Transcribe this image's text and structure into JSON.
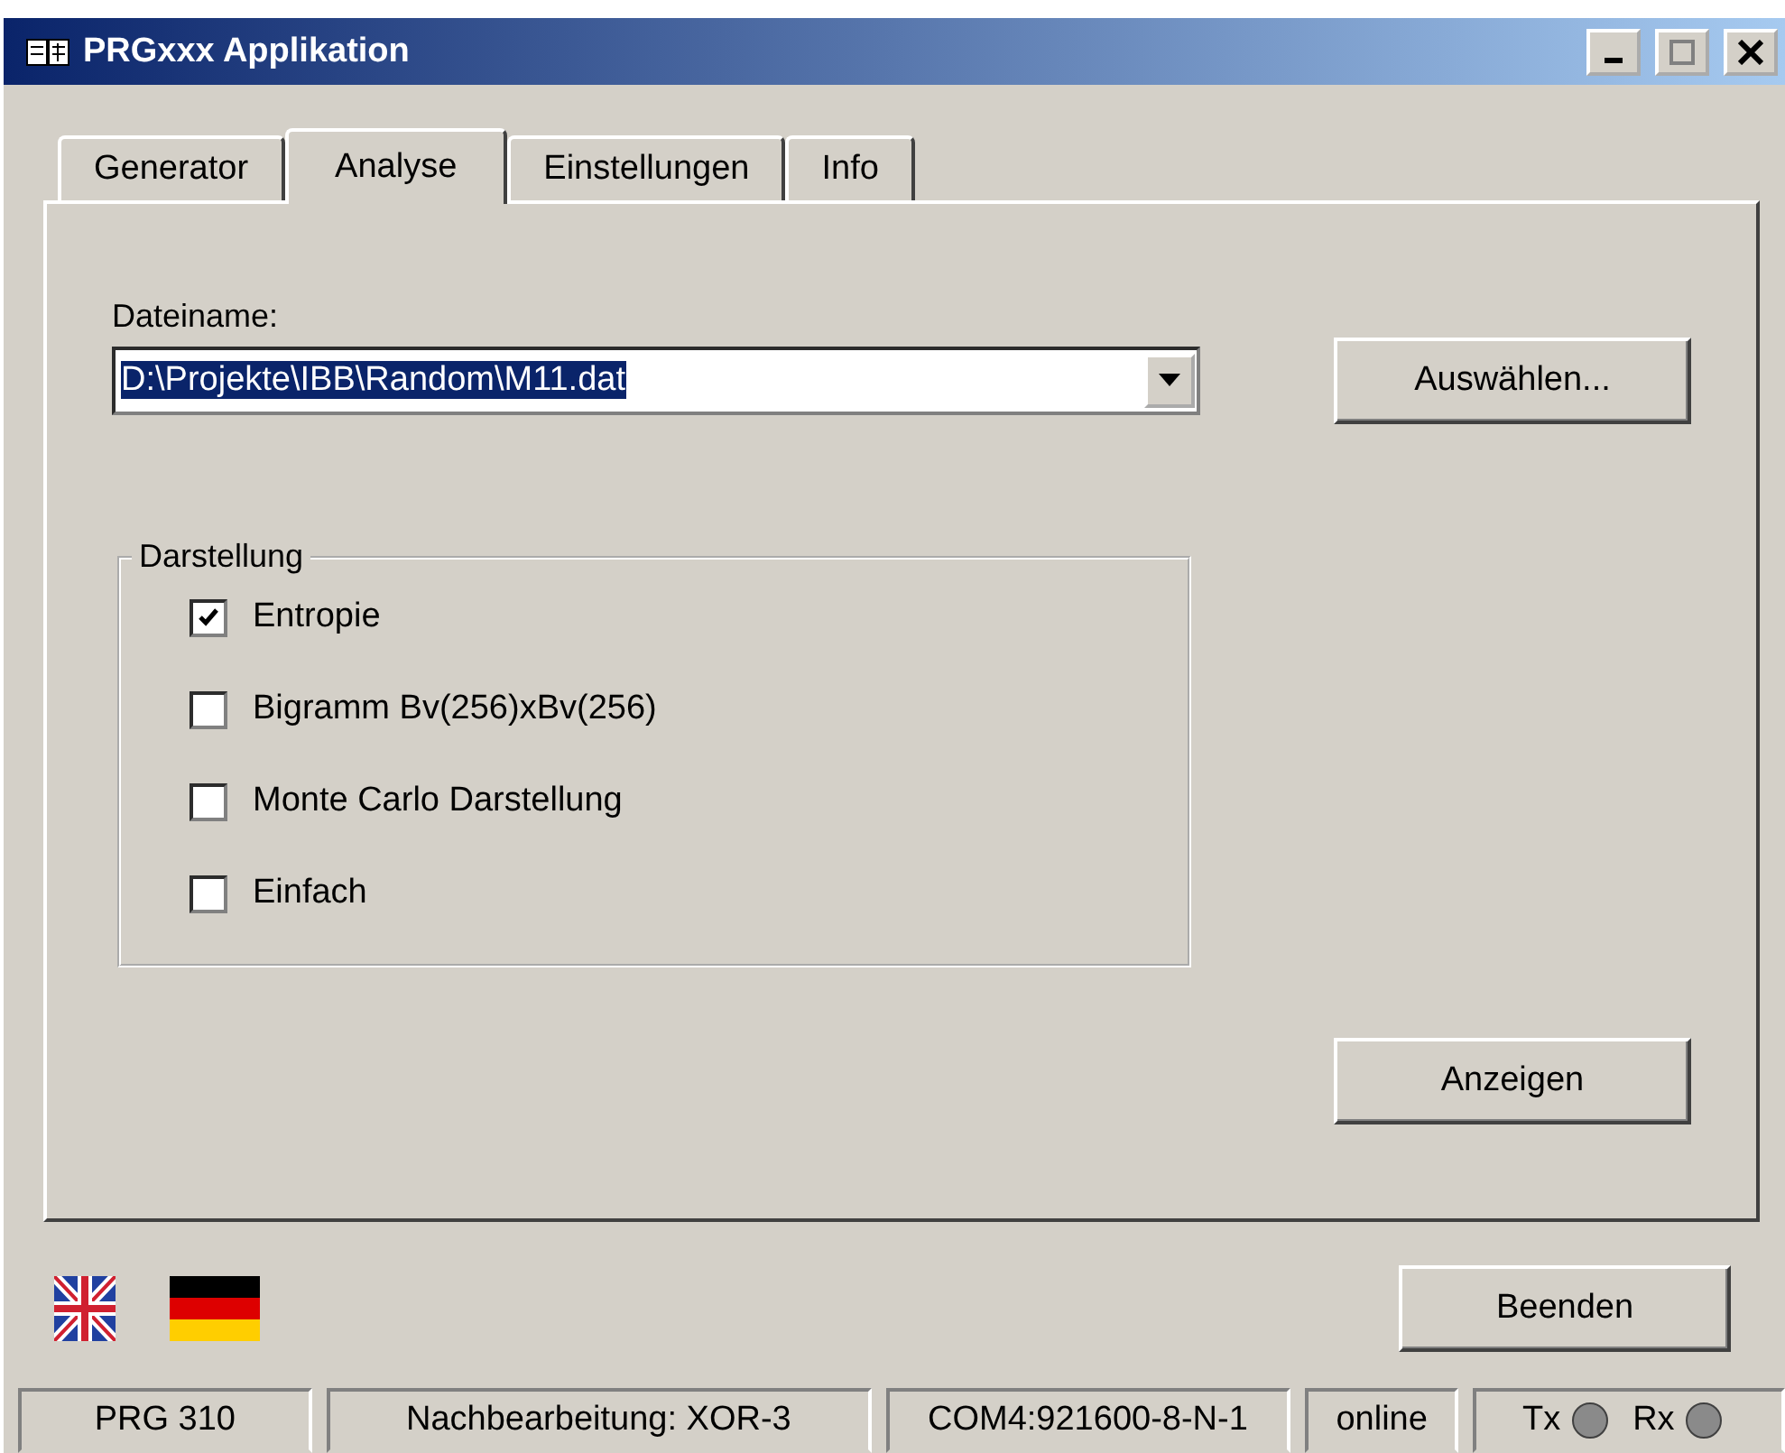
{
  "window": {
    "title": "PRGxxx Applikation"
  },
  "tabs": [
    {
      "label": "Generator",
      "selected": false
    },
    {
      "label": "Analyse",
      "selected": true
    },
    {
      "label": "Einstellungen",
      "selected": false
    },
    {
      "label": "Info",
      "selected": false
    }
  ],
  "file": {
    "label": "Dateiname:",
    "value": "D:\\Projekte\\IBB\\Random\\M11.dat",
    "highlighted": true,
    "button": "Auswählen..."
  },
  "group": {
    "title": "Darstellung",
    "options": [
      {
        "label": "Entropie",
        "checked": true
      },
      {
        "label": "Bigramm Bv(256)xBv(256)",
        "checked": false
      },
      {
        "label": "Monte Carlo Darstellung",
        "checked": false
      },
      {
        "label": "Einfach",
        "checked": false
      }
    ]
  },
  "show_button": "Anzeigen",
  "exit_button": "Beenden",
  "status_bar": {
    "cells": [
      "PRG 310",
      "Nachbearbeitung: XOR-3",
      "COM4:921600-8-N-1",
      "online"
    ],
    "leds": [
      {
        "label": "Tx",
        "on": false
      },
      {
        "label": "Rx",
        "on": false
      }
    ]
  }
}
